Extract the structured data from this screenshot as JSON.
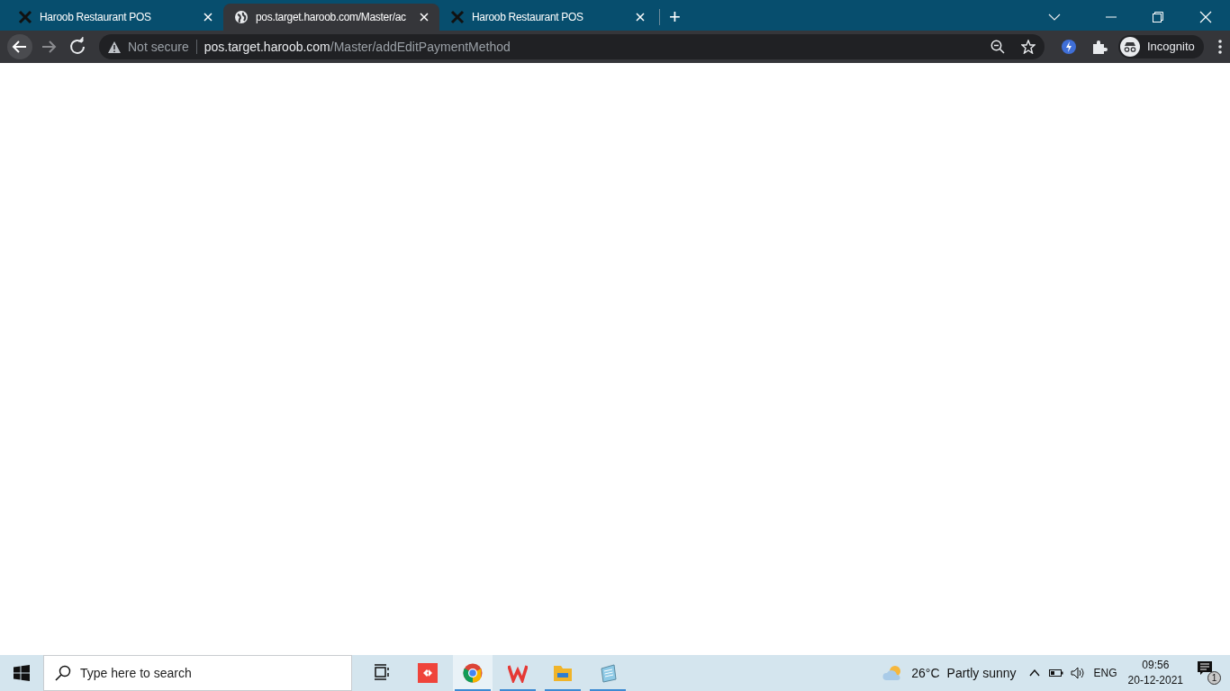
{
  "tabs": [
    {
      "title": "Haroob Restaurant POS",
      "kind": "app",
      "selected": false
    },
    {
      "title": "pos.target.haroob.com/Master/ac",
      "kind": "web",
      "selected": true
    },
    {
      "title": "Haroob Restaurant POS",
      "kind": "app",
      "selected": false
    }
  ],
  "new_tab": "+",
  "address_bar": {
    "security": "Not secure",
    "host": "pos.target.haroob.com",
    "path": "/Master/addEditPaymentMethod"
  },
  "profile": "Incognito",
  "taskbar": {
    "search_placeholder": "Type here to search",
    "apps": [
      {
        "kind": "taskview",
        "running": false,
        "selected": false
      },
      {
        "kind": "remote",
        "running": false,
        "selected": false
      },
      {
        "kind": "browser",
        "running": true,
        "selected": true
      },
      {
        "kind": "office",
        "running": true,
        "selected": false
      },
      {
        "kind": "folder",
        "running": true,
        "selected": false
      },
      {
        "kind": "notepad",
        "running": true,
        "selected": false
      }
    ],
    "weather": {
      "temperature": "26°C",
      "condition": "Partly sunny"
    },
    "language": "ENG",
    "time": "09:56",
    "date": "20-12-2021",
    "notifications": "1"
  }
}
